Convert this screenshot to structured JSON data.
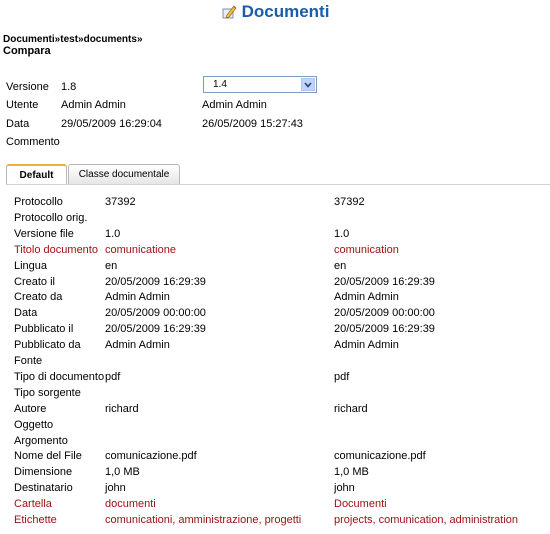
{
  "header": {
    "title": "Documenti"
  },
  "breadcrumb": {
    "items": [
      "Documenti",
      "test",
      "documents"
    ],
    "separator": "»"
  },
  "page_title": "Compara",
  "version": {
    "label": "Versione",
    "current": "1.8",
    "selected": "1.4"
  },
  "info": [
    {
      "label": "Utente",
      "v1": "Admin Admin",
      "v2": "Admin Admin"
    },
    {
      "label": "Data",
      "v1": "29/05/2009 16:29:04",
      "v2": "26/05/2009 15:27:43"
    },
    {
      "label": "Commento",
      "v1": "",
      "v2": ""
    }
  ],
  "tabs": [
    {
      "label": "Default",
      "active": true
    },
    {
      "label": "Classe documentale",
      "active": false
    }
  ],
  "colors": {
    "header": "#1a5da8",
    "diff": "#9a1010",
    "tab_accent": "#f0b030"
  },
  "fields": [
    {
      "label": "Protocollo",
      "v1": "37392",
      "v2": "37392",
      "diff": false
    },
    {
      "label": "Protocollo orig.",
      "v1": "",
      "v2": "",
      "diff": false
    },
    {
      "label": "Versione file",
      "v1": "1.0",
      "v2": "1.0",
      "diff": false
    },
    {
      "label": "Titolo documento",
      "v1": "comunicatione",
      "v2": "comunication",
      "diff": true
    },
    {
      "label": "Lingua",
      "v1": "en",
      "v2": "en",
      "diff": false
    },
    {
      "label": "Creato il",
      "v1": "20/05/2009 16:29:39",
      "v2": "20/05/2009 16:29:39",
      "diff": false
    },
    {
      "label": "Creato da",
      "v1": "Admin Admin",
      "v2": "Admin Admin",
      "diff": false
    },
    {
      "label": "Data",
      "v1": "20/05/2009 00:00:00",
      "v2": "20/05/2009 00:00:00",
      "diff": false
    },
    {
      "label": "Pubblicato il",
      "v1": "20/05/2009 16:29:39",
      "v2": "20/05/2009 16:29:39",
      "diff": false
    },
    {
      "label": "Pubblicato da",
      "v1": "Admin Admin",
      "v2": "Admin Admin",
      "diff": false
    },
    {
      "label": "Fonte",
      "v1": "",
      "v2": "",
      "diff": false
    },
    {
      "label": "Tipo di documento",
      "v1": "pdf",
      "v2": "pdf",
      "diff": false
    },
    {
      "label": "Tipo sorgente",
      "v1": "",
      "v2": "",
      "diff": false
    },
    {
      "label": "Autore",
      "v1": "richard",
      "v2": "richard",
      "diff": false
    },
    {
      "label": "Oggetto",
      "v1": "",
      "v2": "",
      "diff": false
    },
    {
      "label": "Argomento",
      "v1": "",
      "v2": "",
      "diff": false
    },
    {
      "label": "Nome del File",
      "v1": "comunicazione.pdf",
      "v2": "comunicazione.pdf",
      "diff": false
    },
    {
      "label": "Dimensione",
      "v1": "1,0 MB",
      "v2": "1,0 MB",
      "diff": false
    },
    {
      "label": "Destinatario",
      "v1": "john",
      "v2": "john",
      "diff": false
    },
    {
      "label": "Cartella",
      "v1": "documenti",
      "v2": "Documenti",
      "diff": true
    },
    {
      "label": "Etichette",
      "v1": "comunicationi, amministrazione, progetti",
      "v2": "projects, comunication, administration",
      "diff": true
    }
  ]
}
